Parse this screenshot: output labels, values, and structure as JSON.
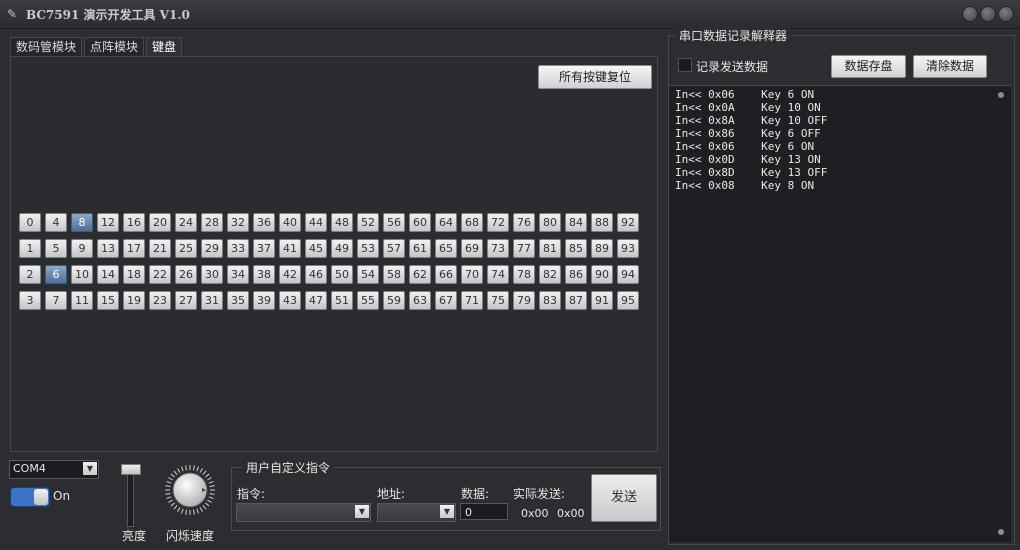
{
  "window": {
    "title": "BC7591 演示开发工具 V1.0"
  },
  "tabs": [
    {
      "label": "数码管模块",
      "active": false
    },
    {
      "label": "点阵模块",
      "active": false
    },
    {
      "label": "键盘",
      "active": true
    }
  ],
  "keyboard": {
    "reset_button": "所有按键复位",
    "keys": [
      [
        "0",
        "4",
        "8",
        "12",
        "16",
        "20",
        "24",
        "28",
        "32",
        "36",
        "40",
        "44",
        "48",
        "52",
        "56",
        "60",
        "64",
        "68",
        "72",
        "76",
        "80",
        "84",
        "88",
        "92"
      ],
      [
        "1",
        "5",
        "9",
        "13",
        "17",
        "21",
        "25",
        "29",
        "33",
        "37",
        "41",
        "45",
        "49",
        "53",
        "57",
        "61",
        "65",
        "69",
        "73",
        "77",
        "81",
        "85",
        "89",
        "93"
      ],
      [
        "2",
        "6",
        "10",
        "14",
        "18",
        "22",
        "26",
        "30",
        "34",
        "38",
        "42",
        "46",
        "50",
        "54",
        "58",
        "62",
        "66",
        "70",
        "74",
        "78",
        "82",
        "86",
        "90",
        "94"
      ],
      [
        "3",
        "7",
        "11",
        "15",
        "19",
        "23",
        "27",
        "31",
        "35",
        "39",
        "43",
        "47",
        "51",
        "55",
        "59",
        "63",
        "67",
        "71",
        "75",
        "79",
        "83",
        "87",
        "91",
        "95"
      ]
    ],
    "pressed": [
      "8",
      "6"
    ]
  },
  "serial": {
    "port": "COM4",
    "toggle_label": "On",
    "toggle_on": true
  },
  "brightness": {
    "label": "亮度"
  },
  "blink": {
    "label": "闪烁速度"
  },
  "custom_cmd": {
    "title": "用户自定义指令",
    "cmd_label": "指令:",
    "addr_label": "地址:",
    "data_label": "数据:",
    "data_value": "0",
    "actual_label": "实际发送:",
    "actual_cmd": "0x00",
    "actual_data": "0x00",
    "send_button": "发送"
  },
  "log_panel": {
    "title": "串口数据记录解释器",
    "record_label": "记录发送数据",
    "record_checked": false,
    "save_button": "数据存盘",
    "clear_button": "清除数据",
    "lines": [
      "In<< 0x06    Key 6 ON",
      "In<< 0x0A    Key 10 ON",
      "In<< 0x8A    Key 10 OFF",
      "In<< 0x86    Key 6 OFF",
      "In<< 0x06    Key 6 ON",
      "In<< 0x0D    Key 13 ON",
      "In<< 0x8D    Key 13 OFF",
      "In<< 0x08    Key 8 ON"
    ]
  }
}
